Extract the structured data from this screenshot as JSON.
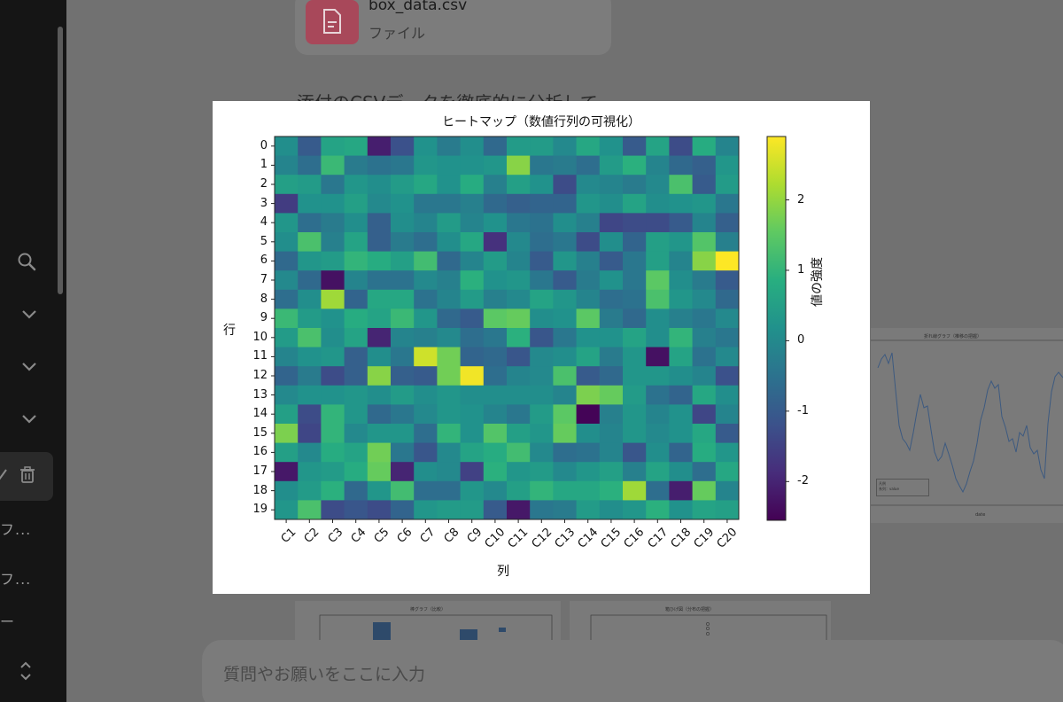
{
  "sidebar": {
    "truncated_items": [
      "フ...",
      "フ..."
    ],
    "dash_item": "ー"
  },
  "file_card": {
    "name": "box_data.csv",
    "type": "ファイル"
  },
  "message_preview": "添付のCSVデータを徹底的に分析して",
  "input": {
    "placeholder": "質問やお願いをここに入力"
  },
  "thumbnails": {
    "line_chart_title": "折れ線グラフ（推移の把握）",
    "line_chart_xlabel": "date",
    "line_legend_title": "凡例",
    "line_legend_item": "系列：value",
    "bar_chart_title": "棒グラフ（比較）",
    "box_chart_title": "箱ひげ図（分布の把握）"
  },
  "colors": {
    "viridis_low": "#440154",
    "viridis_mid": "#21918c",
    "viridis_high": "#fde725"
  },
  "chart_data": {
    "type": "heatmap",
    "title": "ヒートマップ（数値行列の可視化）",
    "xlabel": "列",
    "ylabel": "行",
    "colorbar_label": "値の強度",
    "colorbar_ticks": [
      "2",
      "1",
      "0",
      "-1",
      "-2"
    ],
    "colormap": "viridis",
    "vmin": -2.55,
    "vmax": 2.9,
    "columns": [
      "C1",
      "C2",
      "C3",
      "C4",
      "C5",
      "C6",
      "C7",
      "C8",
      "C9",
      "C10",
      "C11",
      "C12",
      "C13",
      "C14",
      "C15",
      "C16",
      "C17",
      "C18",
      "C19",
      "C20"
    ],
    "rows": [
      "0",
      "1",
      "2",
      "3",
      "4",
      "5",
      "6",
      "7",
      "8",
      "9",
      "10",
      "11",
      "12",
      "13",
      "14",
      "15",
      "16",
      "17",
      "18",
      "19"
    ],
    "values": [
      [
        0.1,
        -1.0,
        0.6,
        0.7,
        -2.1,
        -1.2,
        0.2,
        -0.3,
        0.1,
        -0.7,
        0.4,
        0.4,
        0.0,
        0.7,
        0.2,
        -1.0,
        0.6,
        -1.3,
        0.8,
        -0.1
      ],
      [
        -0.1,
        -0.6,
        1.1,
        -0.3,
        -0.5,
        -0.4,
        0.3,
        0.2,
        0.2,
        0.3,
        1.9,
        -0.4,
        -0.3,
        -0.6,
        0.4,
        0.9,
        -0.1,
        -0.7,
        -0.9,
        0.3
      ],
      [
        0.5,
        0.4,
        -0.4,
        0.3,
        0.1,
        0.4,
        0.7,
        0.2,
        0.8,
        -0.2,
        0.5,
        0.2,
        -1.3,
        0.0,
        -0.1,
        -0.3,
        0.0,
        1.3,
        -1.0,
        0.4
      ],
      [
        -1.6,
        0.2,
        0.2,
        0.5,
        0.0,
        0.2,
        -0.4,
        -0.4,
        -0.2,
        -0.7,
        -0.9,
        -0.8,
        -0.8,
        0.3,
        0.1,
        0.6,
        0.1,
        0.2,
        0.3,
        -0.4
      ],
      [
        0.3,
        -0.6,
        -0.3,
        0.1,
        -0.9,
        0.1,
        -0.1,
        0.4,
        -0.1,
        0.2,
        -0.4,
        -0.5,
        0.1,
        -0.2,
        -1.4,
        -1.3,
        -1.3,
        -1.0,
        -0.1,
        -0.9
      ],
      [
        0.1,
        1.3,
        -0.2,
        0.6,
        -0.9,
        -0.3,
        -0.6,
        0.1,
        0.7,
        -1.8,
        0.0,
        -0.6,
        -0.4,
        -1.3,
        0.1,
        -0.8,
        0.5,
        0.3,
        1.4,
        -0.2
      ],
      [
        -0.7,
        0.3,
        0.4,
        1.0,
        0.8,
        0.5,
        1.2,
        -0.7,
        -0.1,
        0.4,
        -0.1,
        -1.0,
        0.3,
        -0.2,
        -1.0,
        -0.4,
        0.5,
        -0.1,
        1.9,
        2.9
      ],
      [
        0.0,
        -0.7,
        -2.3,
        -0.1,
        -0.5,
        -0.5,
        0.0,
        -0.2,
        0.9,
        0.2,
        0.3,
        -0.4,
        -1.0,
        -0.3,
        0.2,
        -0.4,
        1.5,
        0.1,
        -0.3,
        -1.0
      ],
      [
        -0.6,
        0.1,
        2.1,
        -0.8,
        0.7,
        0.7,
        -0.5,
        -0.1,
        0.4,
        -0.2,
        0.0,
        0.6,
        0.3,
        -0.1,
        -0.6,
        -0.5,
        1.3,
        0.3,
        0.0,
        -0.7
      ],
      [
        1.1,
        0.4,
        0.2,
        0.8,
        0.6,
        1.1,
        0.3,
        -0.7,
        -1.0,
        1.5,
        1.6,
        0.1,
        0.2,
        1.5,
        -0.3,
        -0.7,
        0.1,
        -0.2,
        -0.4,
        0.0
      ],
      [
        0.4,
        1.3,
        0.1,
        0.6,
        -2.0,
        -0.1,
        -0.2,
        0.0,
        -0.6,
        -0.4,
        0.9,
        -1.1,
        -0.4,
        0.2,
        0.2,
        0.6,
        0.1,
        1.0,
        -0.2,
        -0.4
      ],
      [
        -0.1,
        0.2,
        0.3,
        -0.9,
        0.1,
        -0.4,
        2.5,
        1.7,
        -0.8,
        -0.7,
        -1.1,
        0.0,
        0.1,
        0.6,
        -0.3,
        0.3,
        -2.3,
        0.6,
        -0.5,
        0.0
      ],
      [
        -0.8,
        -0.3,
        -1.3,
        -0.9,
        1.9,
        -0.9,
        -1.0,
        1.7,
        2.8,
        -0.6,
        -0.1,
        0.0,
        1.3,
        -1.0,
        -0.7,
        0.3,
        0.3,
        0.1,
        -0.1,
        -1.2
      ],
      [
        0.0,
        0.2,
        0.2,
        0.3,
        0.1,
        0.4,
        0.1,
        0.3,
        0.1,
        0.1,
        0.1,
        0.1,
        -0.1,
        1.8,
        1.6,
        0.4,
        -0.5,
        -0.8,
        0.7,
        0.1
      ],
      [
        0.5,
        -1.3,
        1.0,
        0.3,
        -0.7,
        -0.4,
        0.0,
        0.3,
        0.2,
        -0.1,
        -0.4,
        0.4,
        1.5,
        -2.5,
        -0.2,
        0.3,
        -0.1,
        0.2,
        -1.4,
        -0.1
      ],
      [
        1.8,
        -1.4,
        1.0,
        0.0,
        0.3,
        0.3,
        -0.6,
        1.0,
        0.2,
        1.4,
        0.5,
        0.3,
        1.6,
        0.1,
        -0.1,
        0.3,
        0.0,
        0.2,
        0.7,
        -1.0
      ],
      [
        0.5,
        0.0,
        0.8,
        0.6,
        1.7,
        -0.4,
        -1.1,
        0.0,
        0.6,
        0.8,
        1.2,
        0.0,
        -0.6,
        -0.5,
        -0.1,
        -1.1,
        0.1,
        -0.8,
        0.8,
        0.3
      ],
      [
        -2.2,
        0.3,
        0.4,
        0.8,
        1.6,
        -2.0,
        0.1,
        0.0,
        -1.5,
        0.9,
        0.3,
        0.4,
        0.0,
        0.3,
        0.5,
        -0.2,
        0.6,
        0.1,
        -0.6,
        0.7
      ],
      [
        0.1,
        0.4,
        0.9,
        -0.7,
        0.3,
        1.2,
        -0.6,
        -0.6,
        0.3,
        0.0,
        0.5,
        1.0,
        0.7,
        0.7,
        0.9,
        2.1,
        -0.6,
        -2.1,
        1.6,
        -0.1
      ],
      [
        0.3,
        1.3,
        -1.3,
        -1.1,
        -1.3,
        -0.8,
        0.3,
        0.4,
        0.4,
        -1.0,
        -2.2,
        -0.4,
        -0.3,
        0.4,
        0.1,
        0.3,
        0.9,
        0.2,
        0.6,
        0.5
      ]
    ]
  }
}
